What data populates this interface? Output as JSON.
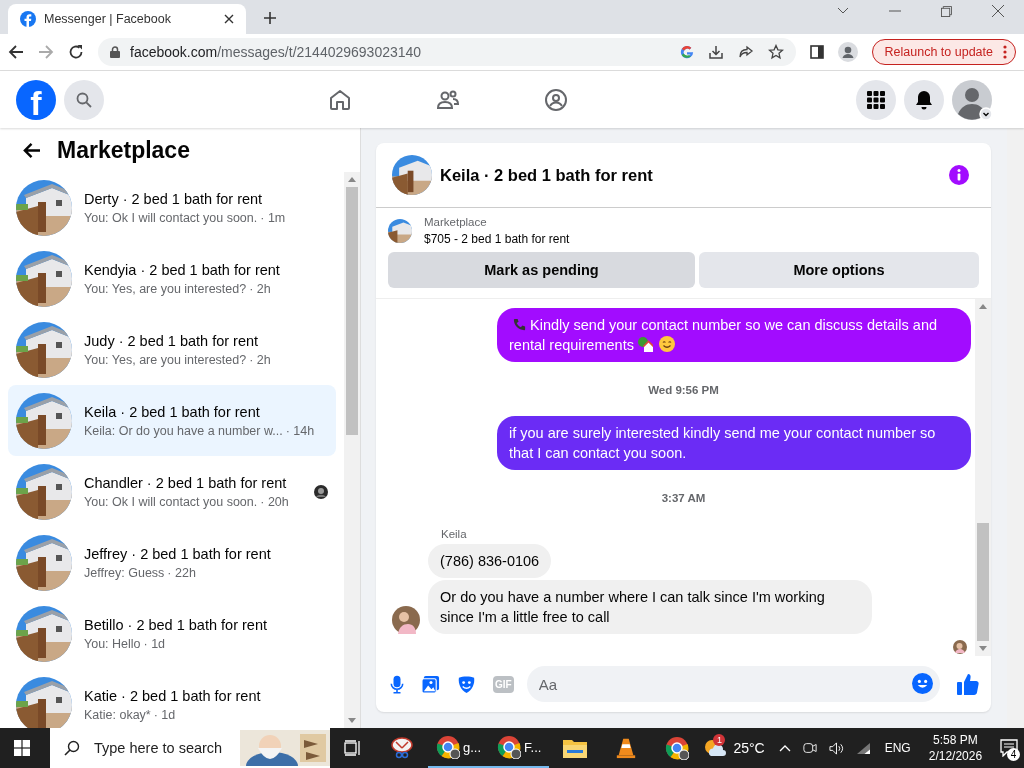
{
  "browser": {
    "tab_title": "Messenger | Facebook",
    "url_host": "facebook.com",
    "url_path": "/messages/t/2144029693023140",
    "relaunch_label": "Relaunch to update"
  },
  "header": {
    "logo_letter": "f"
  },
  "sidebar": {
    "title": "Marketplace",
    "conversations": [
      {
        "name": "Derty · 2 bed 1 bath for rent",
        "preview": "You: Ok I will contact you soon.",
        "time": "· 1m",
        "selected": false,
        "seen": false
      },
      {
        "name": "Kendyia · 2 bed 1 bath for rent",
        "preview": "You: Yes, are you interested?",
        "time": "· 2h",
        "selected": false,
        "seen": false
      },
      {
        "name": "Judy · 2 bed 1 bath for rent",
        "preview": "You: Yes, are you interested?",
        "time": "· 2h",
        "selected": false,
        "seen": false
      },
      {
        "name": "Keila · 2 bed 1 bath for rent",
        "preview": "Keila: Or do you have a number w...",
        "time": "· 14h",
        "selected": true,
        "seen": false
      },
      {
        "name": "Chandler · 2 bed 1 bath for rent",
        "preview": "You: Ok I will contact you soon.",
        "time": "· 20h",
        "selected": false,
        "seen": true
      },
      {
        "name": "Jeffrey · 2 bed 1 bath for rent",
        "preview": "Jeffrey: Guess",
        "time": "· 22h",
        "selected": false,
        "seen": false
      },
      {
        "name": "Betillo · 2 bed 1 bath for rent",
        "preview": "You: Hello",
        "time": "· 1d",
        "selected": false,
        "seen": false
      },
      {
        "name": "Katie · 2 bed 1 bath for rent",
        "preview": "Katie: okay*",
        "time": "· 1d",
        "selected": false,
        "seen": false
      }
    ]
  },
  "chat": {
    "title": "Keila · 2 bed 1 bath for rent",
    "listing": {
      "source": "Marketplace",
      "summary": "$705 - 2 bed 1 bath for rent"
    },
    "buttons": [
      "Mark as pending",
      "More options"
    ],
    "messages": [
      {
        "kind": "outgoing",
        "text": "Kindly send your contact number so we can discuss details and rental requirements",
        "color": "#a20cff"
      },
      {
        "kind": "time",
        "text": "Wed 9:56 PM"
      },
      {
        "kind": "outgoing",
        "text": "if you are surely interested kindly send me your contact number so that I can contact you soon.",
        "color": "#6b2cf5"
      },
      {
        "kind": "time",
        "text": "3:37 AM"
      },
      {
        "kind": "sender",
        "text": "Keila"
      },
      {
        "kind": "incoming",
        "text": "(786) 836-0106"
      },
      {
        "kind": "incoming",
        "text": "Or do you have a number where I can talk since I'm working since I'm a little free to call"
      }
    ],
    "composer": {
      "placeholder": "Aa",
      "gif_label": "GIF"
    }
  },
  "taskbar": {
    "search_placeholder": "Type here to search",
    "apps": [
      {
        "label": "g...",
        "kind": "chrome"
      },
      {
        "label": "F...",
        "kind": "chrome"
      }
    ],
    "weather_badge": "1",
    "temperature": "25°C",
    "language": "ENG",
    "time": "5:58 PM",
    "date": "2/12/2026",
    "notifications": "4"
  }
}
